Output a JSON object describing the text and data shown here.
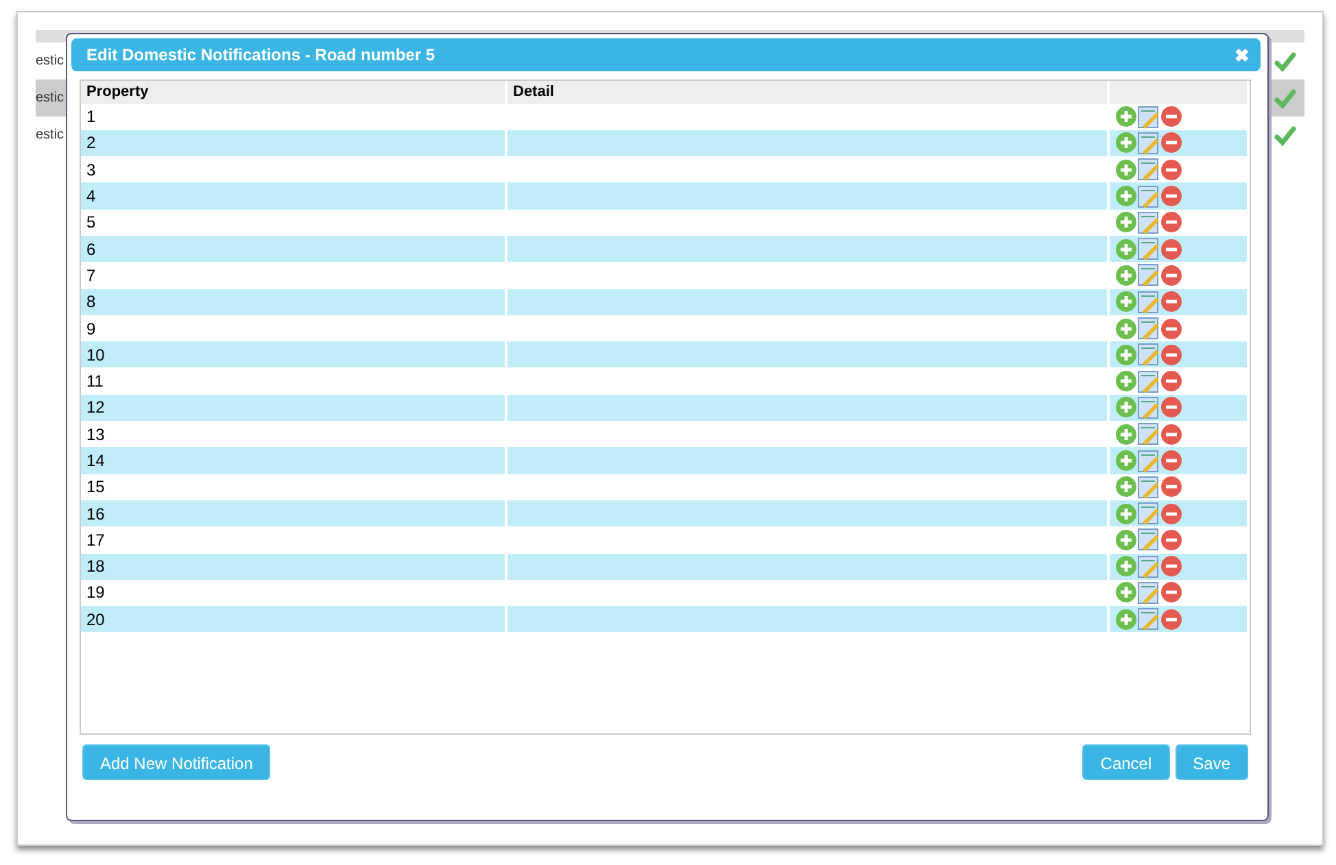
{
  "background": {
    "rows": [
      {
        "text": "estic",
        "checked": true
      },
      {
        "text": "estic",
        "checked": true
      },
      {
        "text": "estic",
        "checked": true
      }
    ]
  },
  "dialog": {
    "title": "Edit Domestic Notifications - Road number 5",
    "close": "✖",
    "table": {
      "columns": [
        "Property",
        "Detail"
      ],
      "rows": [
        {
          "property": "1"
        },
        {
          "property": "2"
        },
        {
          "property": "3"
        },
        {
          "property": "4"
        },
        {
          "property": "5"
        },
        {
          "property": "6"
        },
        {
          "property": "7"
        },
        {
          "property": "8"
        },
        {
          "property": "9"
        },
        {
          "property": "10"
        },
        {
          "property": "11"
        },
        {
          "property": "12"
        },
        {
          "property": "13"
        },
        {
          "property": "14"
        },
        {
          "property": "15"
        },
        {
          "property": "16"
        },
        {
          "property": "17"
        },
        {
          "property": "18"
        },
        {
          "property": "19"
        },
        {
          "property": "20"
        }
      ]
    },
    "add_button": "Add New Notification",
    "buttons": [
      "Cancel",
      "Save"
    ]
  }
}
